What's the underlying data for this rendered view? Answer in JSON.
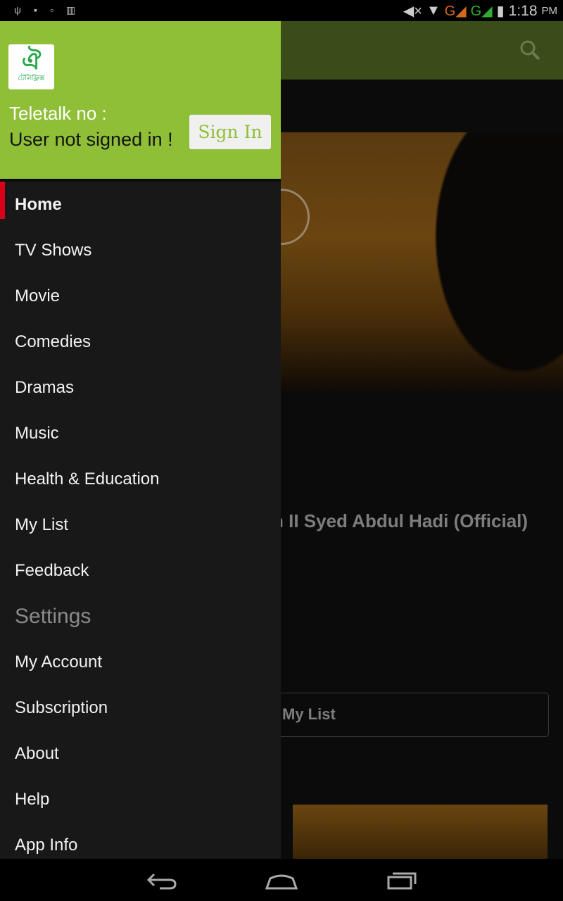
{
  "status_bar": {
    "time": "1:18",
    "ampm": "PM",
    "icons": [
      "usb-icon",
      "lock-icon",
      "image-icon",
      "sd-card-icon",
      "mute-icon",
      "wifi-icon",
      "signal-g-orange-icon",
      "signal-g-green-icon",
      "battery-charging-icon"
    ]
  },
  "background": {
    "video_title_visible": "n II Syed Abdul Hadi (Official)",
    "my_list_label": "My List"
  },
  "drawer": {
    "logo_text": "টেলিফ্লিক্স",
    "teletalk_label": "Teletalk no :",
    "user_status": "User not signed in !",
    "sign_in": "Sign In",
    "items": [
      {
        "label": "Home",
        "selected": true
      },
      {
        "label": "TV Shows"
      },
      {
        "label": "Movie"
      },
      {
        "label": "Comedies"
      },
      {
        "label": "Dramas"
      },
      {
        "label": "Music"
      },
      {
        "label": "Health & Education"
      },
      {
        "label": "My List"
      },
      {
        "label": "Feedback"
      },
      {
        "label": "Settings",
        "header": true
      },
      {
        "label": "My Account"
      },
      {
        "label": "Subscription"
      },
      {
        "label": "About"
      },
      {
        "label": "Help"
      },
      {
        "label": "App Info"
      }
    ]
  },
  "colors": {
    "header_green": "#8fbf37",
    "selected_indicator": "#d9001b",
    "toolbar_dim": "#3a4d18"
  }
}
